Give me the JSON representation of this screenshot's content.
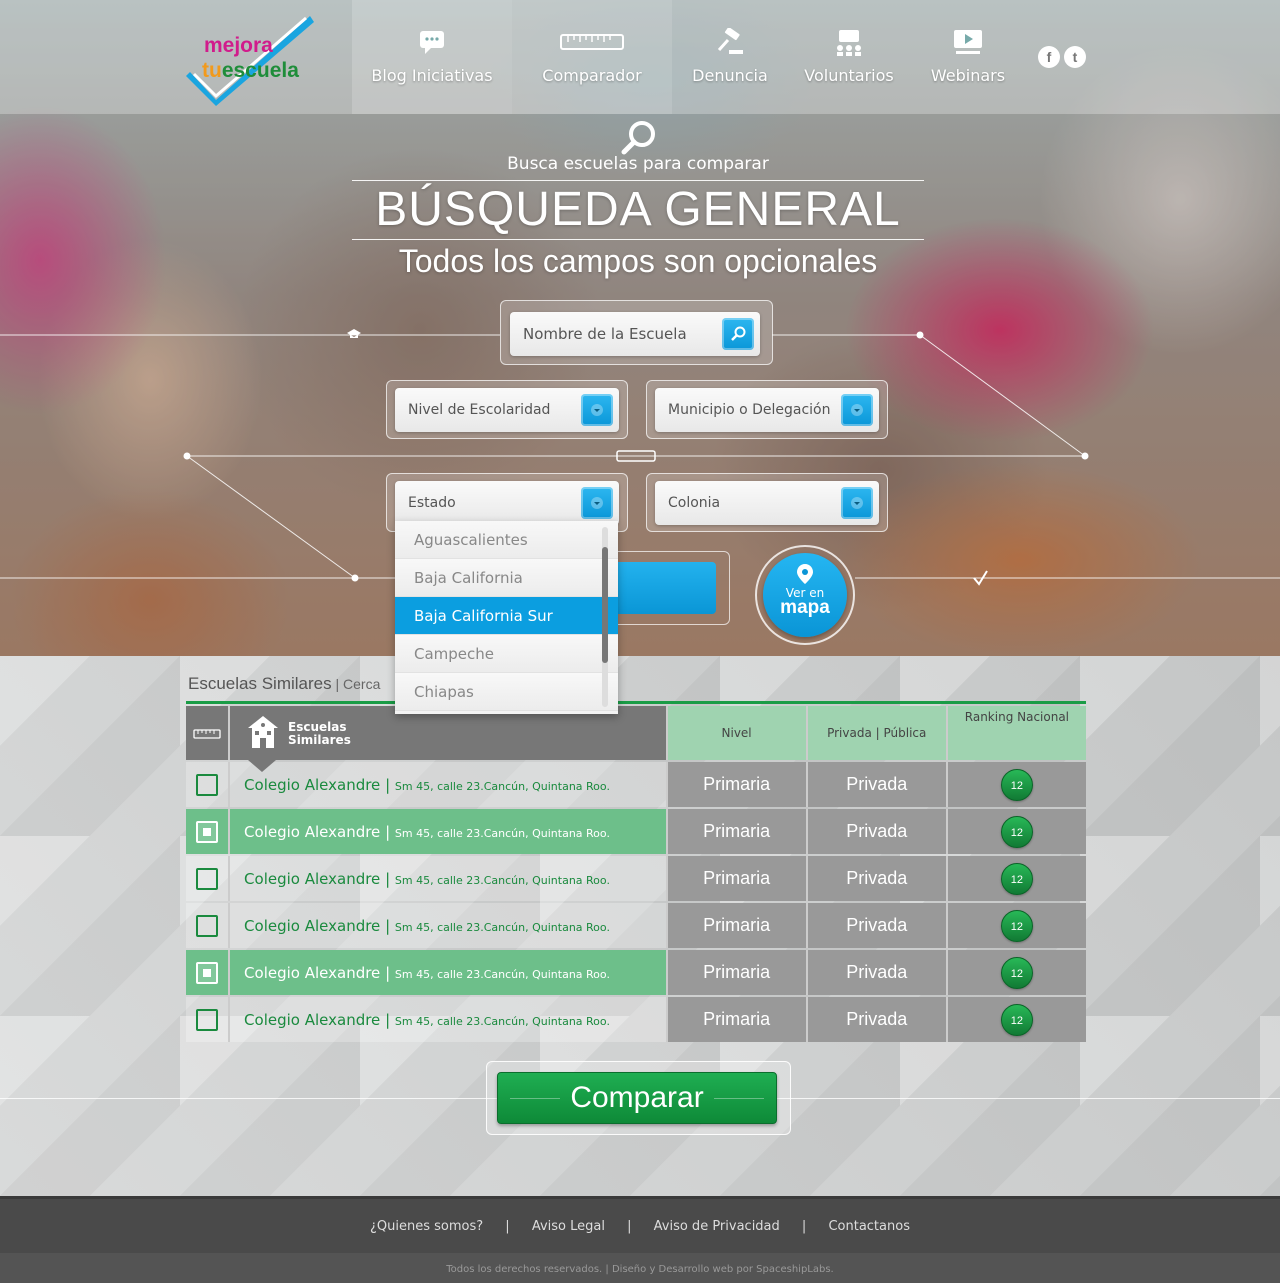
{
  "logo": {
    "line1": "mejora",
    "line2_prefix": "tu",
    "line2_rest": "escuela"
  },
  "nav": [
    {
      "label": "Blog Iniciativas",
      "icon": "chat-bubble-icon"
    },
    {
      "label": "Comparador",
      "icon": "ruler-icon"
    },
    {
      "label": "Denuncia",
      "icon": "gavel-icon"
    },
    {
      "label": "Voluntarios",
      "icon": "people-icon"
    },
    {
      "label": "Webinars",
      "icon": "video-screen-icon"
    }
  ],
  "social": {
    "facebook": "f",
    "twitter": "t"
  },
  "hero": {
    "kicker": "Busca escuelas para comparar",
    "title": "BÚSQUEDA GENERAL",
    "subtitle": "Todos los campos son opcionales"
  },
  "form": {
    "school_name_placeholder": "Nombre de la Escuela",
    "level_label": "Nivel de Escolaridad",
    "municipality_label": "Municipio o Delegación",
    "state_label": "Estado",
    "colony_label": "Colonia",
    "state_options": [
      "Aguascalientes",
      "Baja California",
      "Baja California Sur",
      "Campeche",
      "Chiapas"
    ],
    "state_selected": "Baja California Sur",
    "map_button": {
      "line1": "Ver en",
      "line2": "mapa"
    }
  },
  "results": {
    "section_title": "Escuelas Similares",
    "section_suffix": " | Cerca",
    "headers": {
      "school": "Escuelas Similares",
      "level": "Nivel",
      "type": "Privada | Pública",
      "rank": "Ranking Nacional"
    },
    "rows": [
      {
        "name": "Colegio Alexandre",
        "address": "Sm 45, calle 23.Cancún, Quintana Roo.",
        "level": "Primaria",
        "type": "Privada",
        "rank": "12",
        "checked": false
      },
      {
        "name": "Colegio Alexandre",
        "address": "Sm 45, calle 23.Cancún, Quintana Roo.",
        "level": "Primaria",
        "type": "Privada",
        "rank": "12",
        "checked": true
      },
      {
        "name": "Colegio Alexandre",
        "address": "Sm 45, calle 23.Cancún, Quintana Roo.",
        "level": "Primaria",
        "type": "Privada",
        "rank": "12",
        "checked": false
      },
      {
        "name": "Colegio Alexandre",
        "address": "Sm 45, calle 23.Cancún, Quintana Roo.",
        "level": "Primaria",
        "type": "Privada",
        "rank": "12",
        "checked": false
      },
      {
        "name": "Colegio Alexandre",
        "address": "Sm 45, calle 23.Cancún, Quintana Roo.",
        "level": "Primaria",
        "type": "Privada",
        "rank": "12",
        "checked": true
      },
      {
        "name": "Colegio Alexandre",
        "address": "Sm 45, calle 23.Cancún, Quintana Roo.",
        "level": "Primaria",
        "type": "Privada",
        "rank": "12",
        "checked": false
      }
    ],
    "compare_button": "Comparar"
  },
  "footer": {
    "links": [
      "¿Quienes somos?",
      "Aviso Legal",
      "Aviso de Privacidad",
      "Contactanos"
    ],
    "separator": "|",
    "copyright": "Todos los derechos reservados. | Diseño y Desarrollo web por SpaceshipLabs."
  },
  "colors": {
    "accent_blue": "#0b9ee0",
    "accent_green": "#1a9c46",
    "brand_pink": "#d11c8c",
    "brand_orange": "#f29a1c"
  }
}
